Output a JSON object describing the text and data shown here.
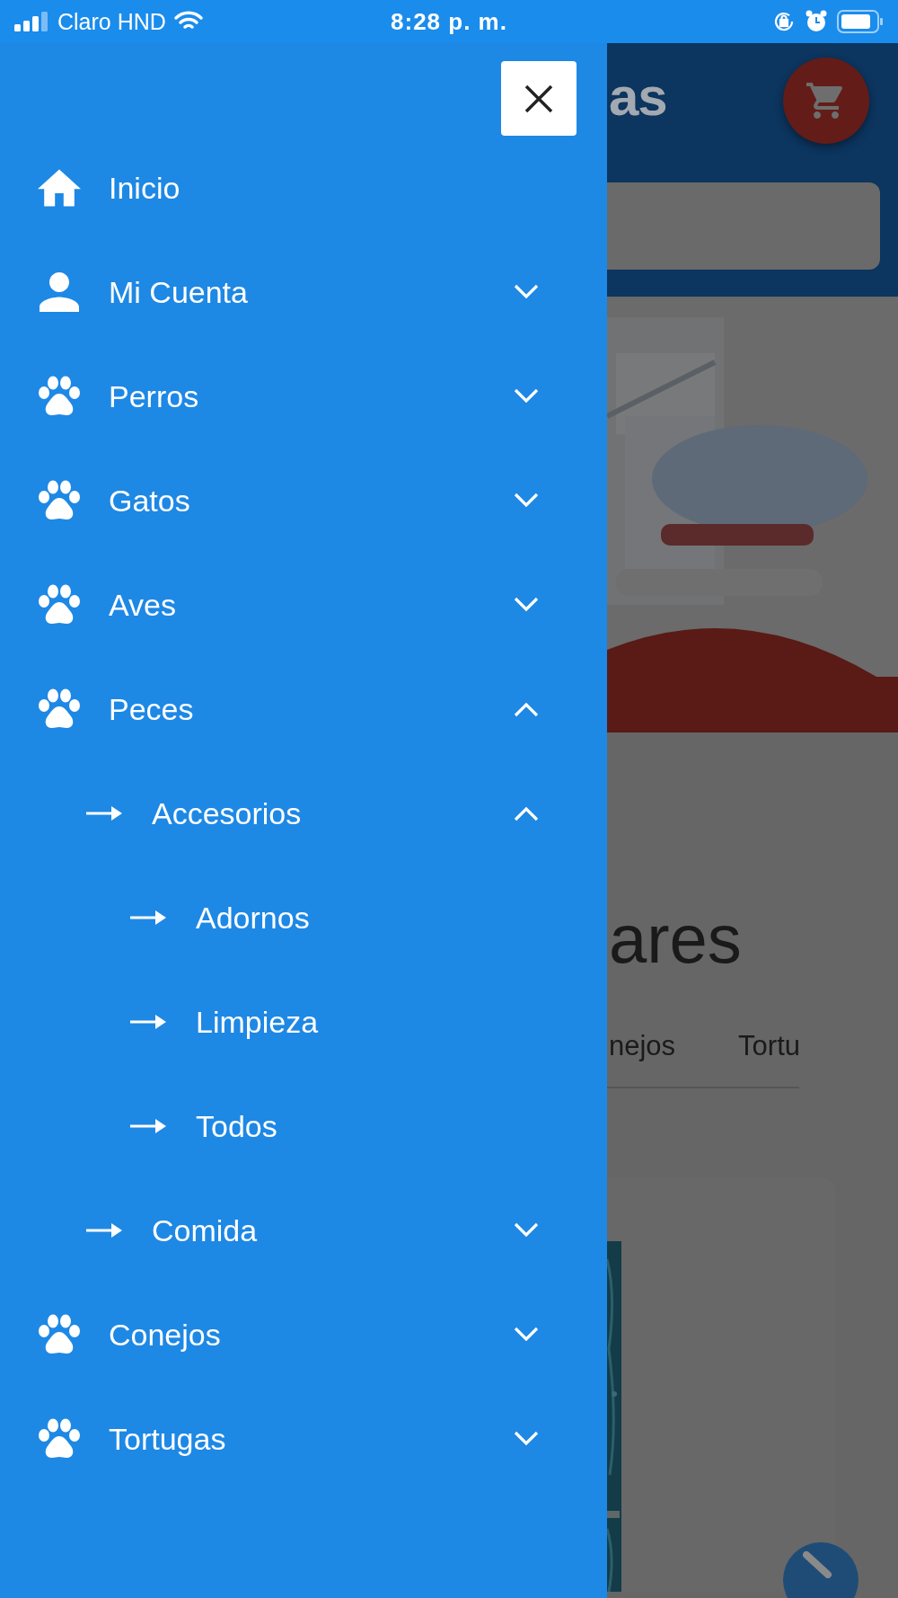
{
  "status_bar": {
    "carrier": "Claro HND",
    "time": "8:28 p. m."
  },
  "drawer": {
    "menu": [
      {
        "kind": "home",
        "label": "Inicio"
      },
      {
        "kind": "person",
        "label": "Mi Cuenta",
        "expanded": false
      },
      {
        "kind": "paw",
        "label": "Perros",
        "expanded": false
      },
      {
        "kind": "paw",
        "label": "Gatos",
        "expanded": false
      },
      {
        "kind": "paw",
        "label": "Aves",
        "expanded": false
      },
      {
        "kind": "paw",
        "label": "Peces",
        "expanded": true,
        "children": [
          {
            "kind": "arrow",
            "label": "Accesorios",
            "expanded": true,
            "children": [
              {
                "kind": "arrow",
                "label": "Adornos"
              },
              {
                "kind": "arrow",
                "label": "Limpieza"
              },
              {
                "kind": "arrow",
                "label": "Todos"
              }
            ]
          },
          {
            "kind": "arrow",
            "label": "Comida",
            "expanded": false
          }
        ]
      },
      {
        "kind": "paw",
        "label": "Conejos",
        "expanded": false
      },
      {
        "kind": "paw",
        "label": "Tortugas",
        "expanded": false
      }
    ]
  },
  "background_page": {
    "logo_text": "as",
    "section_title": "ares",
    "tabs": [
      {
        "label": "nejos"
      },
      {
        "label": "Tortu"
      }
    ]
  }
}
